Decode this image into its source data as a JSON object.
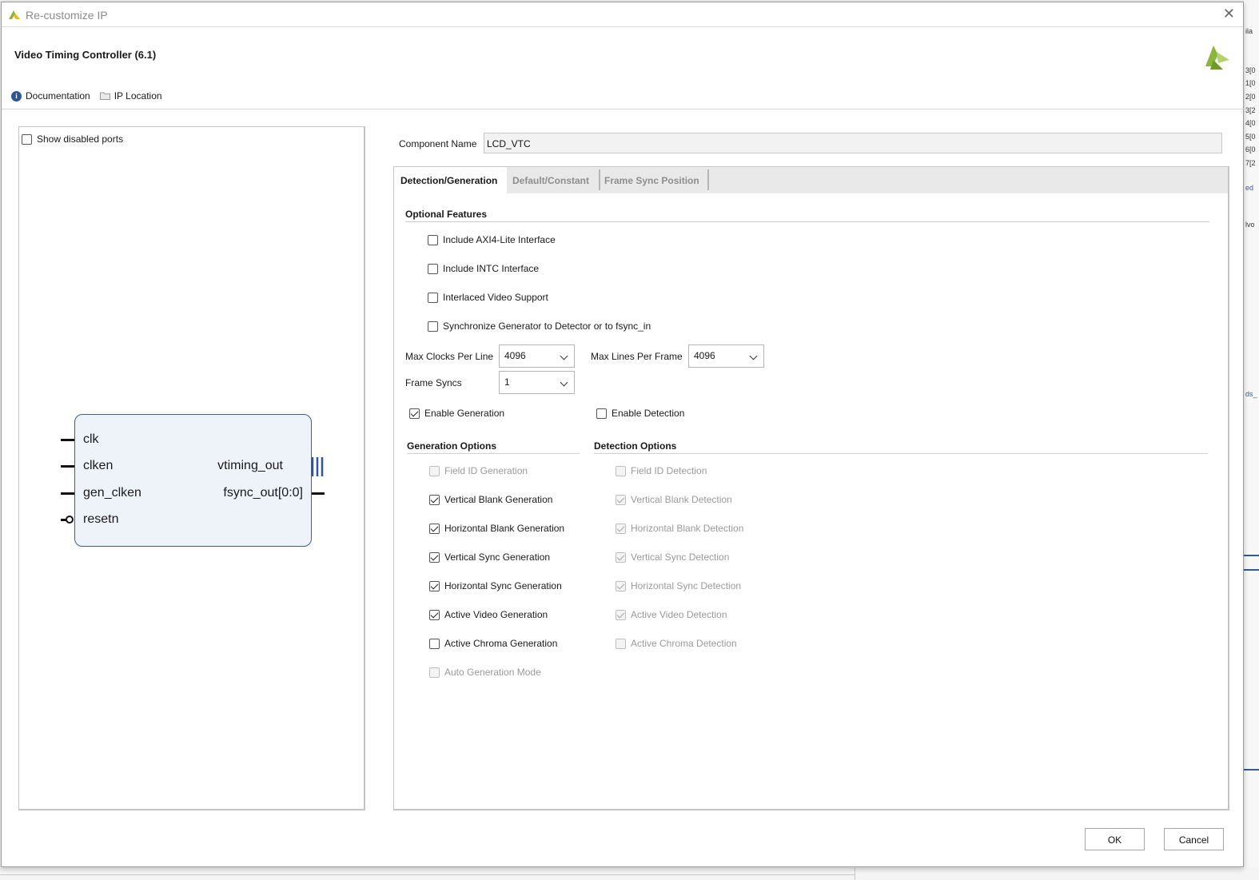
{
  "window": {
    "title": "Re-customize IP",
    "close_glyph": "✕"
  },
  "ip": {
    "name": "Video Timing Controller (6.1)"
  },
  "links": {
    "documentation": "Documentation",
    "ip_location": "IP Location"
  },
  "left_panel": {
    "show_disabled_ports_label": "Show disabled ports",
    "show_disabled_ports_checked": false,
    "symbol": {
      "inputs": [
        "clk",
        "clken",
        "gen_clken",
        "resetn"
      ],
      "outputs": [
        "vtiming_out",
        "fsync_out[0:0]"
      ]
    }
  },
  "component": {
    "label": "Component Name",
    "value": "LCD_VTC"
  },
  "tabs": [
    {
      "label": "Detection/Generation",
      "active": true
    },
    {
      "label": "Default/Constant",
      "active": false
    },
    {
      "label": "Frame Sync Position",
      "active": false
    }
  ],
  "optional_features": {
    "title": "Optional Features",
    "items": [
      {
        "label": "Include AXI4-Lite Interface",
        "checked": false
      },
      {
        "label": "Include INTC Interface",
        "checked": false
      },
      {
        "label": "Interlaced Video Support",
        "checked": false
      },
      {
        "label": "Synchronize Generator to Detector or to fsync_in",
        "checked": false
      }
    ]
  },
  "params": {
    "max_clocks_label": "Max Clocks Per Line",
    "max_clocks_value": "4096",
    "max_lines_label": "Max Lines Per Frame",
    "max_lines_value": "4096",
    "frame_syncs_label": "Frame Syncs",
    "frame_syncs_value": "1"
  },
  "enable": {
    "generation_label": "Enable Generation",
    "generation_checked": true,
    "detection_label": "Enable Detection",
    "detection_checked": false
  },
  "generation_options": {
    "title": "Generation Options",
    "items": [
      {
        "label": "Field ID Generation",
        "checked": false,
        "disabled": true
      },
      {
        "label": "Vertical Blank Generation",
        "checked": true,
        "disabled": false
      },
      {
        "label": "Horizontal Blank Generation",
        "checked": true,
        "disabled": false
      },
      {
        "label": "Vertical Sync Generation",
        "checked": true,
        "disabled": false
      },
      {
        "label": "Horizontal Sync Generation",
        "checked": true,
        "disabled": false
      },
      {
        "label": "Active Video Generation",
        "checked": true,
        "disabled": false
      },
      {
        "label": "Active Chroma Generation",
        "checked": false,
        "disabled": false
      },
      {
        "label": "Auto Generation Mode",
        "checked": false,
        "disabled": true
      }
    ]
  },
  "detection_options": {
    "title": "Detection Options",
    "items": [
      {
        "label": "Field ID Detection",
        "checked": false,
        "disabled": true
      },
      {
        "label": "Vertical Blank Detection",
        "checked": true,
        "disabled": true
      },
      {
        "label": "Horizontal Blank Detection",
        "checked": true,
        "disabled": true
      },
      {
        "label": "Vertical Sync Detection",
        "checked": true,
        "disabled": true
      },
      {
        "label": "Horizontal Sync Detection",
        "checked": true,
        "disabled": true
      },
      {
        "label": "Active Video Detection",
        "checked": true,
        "disabled": true
      },
      {
        "label": "Active Chroma Detection",
        "checked": false,
        "disabled": true
      }
    ]
  },
  "buttons": {
    "ok": "OK",
    "cancel": "Cancel"
  },
  "background_fragments": [
    "ila",
    "3[0",
    "1[0",
    "2[0",
    "3[2",
    "4[0",
    "5[0",
    "6[0",
    "7[2",
    "ed",
    "lvo",
    "ds_"
  ],
  "colors": {
    "accent_blue": "#2e5596",
    "block_fill": "#eef3fa",
    "block_border": "#3d5f91",
    "logo_green": "#8db43c"
  }
}
